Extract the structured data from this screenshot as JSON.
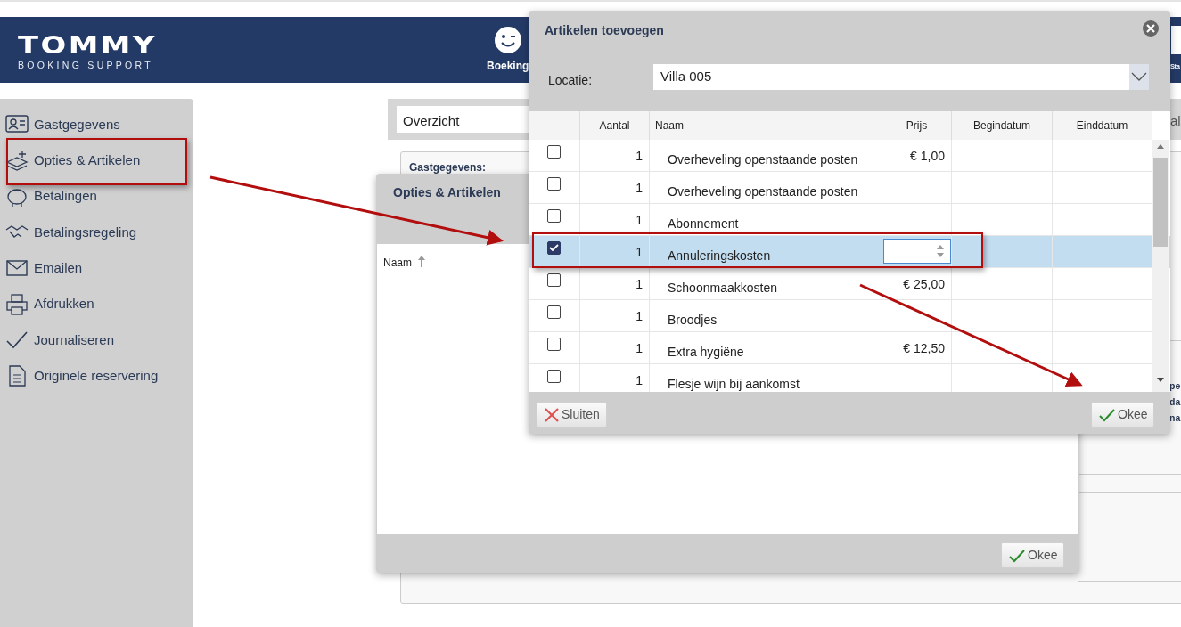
{
  "header": {
    "logo_title": "TOMMY",
    "logo_subtitle": "BOOKING SUPPORT",
    "nav": [
      {
        "label": "Boeking"
      },
      {
        "label": "Sta"
      }
    ]
  },
  "sidebar": {
    "items": [
      {
        "label": "Gastgegevens",
        "annotated": false
      },
      {
        "label": "Opties & Artikelen",
        "annotated": true
      },
      {
        "label": "Betalingen",
        "annotated": false
      },
      {
        "label": "Betalingsregeling",
        "annotated": false
      },
      {
        "label": "Emailen",
        "annotated": false
      },
      {
        "label": "Afdrukken",
        "annotated": false
      },
      {
        "label": "Journaliseren",
        "annotated": false
      },
      {
        "label": "Originele reservering",
        "annotated": false
      }
    ]
  },
  "main": {
    "view_select": "Overzicht",
    "tab_fragment": "al",
    "section_label": "Gastgegevens:",
    "side_fragments": [
      "pe",
      "da",
      "na"
    ]
  },
  "options_dialog": {
    "title": "Opties & Artikelen",
    "column": "Naam",
    "ok_button": "Okee"
  },
  "add_dialog": {
    "title": "Artikelen toevoegen",
    "location_label": "Locatie:",
    "location_value": "Villa 005",
    "columns": [
      "Aantal",
      "Naam",
      "Prijs",
      "Begindatum",
      "Einddatum"
    ],
    "rows": [
      {
        "checked": false,
        "selected": false,
        "annotated": false,
        "price_editing": false,
        "quantity": "1",
        "name": "Overheveling openstaande posten",
        "price": "€ 1,00"
      },
      {
        "checked": false,
        "selected": false,
        "annotated": false,
        "price_editing": false,
        "quantity": "1",
        "name": "Overheveling openstaande posten"
      },
      {
        "checked": false,
        "selected": false,
        "annotated": false,
        "price_editing": false,
        "quantity": "1",
        "name": "Abonnement"
      },
      {
        "checked": true,
        "selected": true,
        "annotated": true,
        "price_editing": true,
        "quantity": "1",
        "name": "Annuleringskosten"
      },
      {
        "checked": false,
        "selected": false,
        "annotated": false,
        "price_editing": false,
        "quantity": "1",
        "name": "Schoonmaakkosten",
        "price": "€ 25,00"
      },
      {
        "checked": false,
        "selected": false,
        "annotated": false,
        "price_editing": false,
        "quantity": "1",
        "name": "Broodjes"
      },
      {
        "checked": false,
        "selected": false,
        "annotated": false,
        "price_editing": false,
        "quantity": "1",
        "name": "Extra hygiëne",
        "price": "€ 12,50"
      },
      {
        "checked": false,
        "selected": false,
        "annotated": false,
        "price_editing": false,
        "quantity": "1",
        "name": "Flesje wijn bij aankomst"
      }
    ],
    "close_button": "Sluiten",
    "ok_button": "Okee"
  }
}
